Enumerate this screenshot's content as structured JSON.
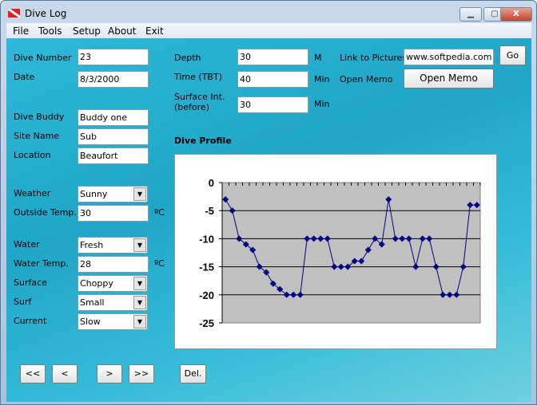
{
  "window": {
    "title": "Dive Log",
    "minimize": "▁",
    "maximize": "▢",
    "close": "X"
  },
  "menu": [
    "File",
    "Tools",
    "Setup",
    "About",
    "Exit"
  ],
  "fields": {
    "dive_number": {
      "label": "Dive Number",
      "value": "23"
    },
    "date": {
      "label": "Date",
      "value": "8/3/2000"
    },
    "dive_buddy": {
      "label": "Dive Buddy",
      "value": "Buddy one"
    },
    "site_name": {
      "label": "Site Name",
      "value": "Sub"
    },
    "location": {
      "label": "Location",
      "value": "Beaufort"
    },
    "weather": {
      "label": "Weather",
      "value": "Sunny"
    },
    "outside_temp": {
      "label": "Outside Temp.",
      "value": "30",
      "unit": "ºC"
    },
    "water": {
      "label": "Water",
      "value": "Fresh"
    },
    "water_temp": {
      "label": "Water Temp.",
      "value": "28",
      "unit": "ºC"
    },
    "surface": {
      "label": "Surface",
      "value": "Choppy"
    },
    "surf": {
      "label": "Surf",
      "value": "Small"
    },
    "current": {
      "label": "Current",
      "value": "Slow"
    },
    "depth": {
      "label": "Depth",
      "value": "30",
      "unit": "M"
    },
    "time": {
      "label": "Time (TBT)",
      "value": "40",
      "unit": "Min"
    },
    "surface_int": {
      "label": "Surface Int. (before)",
      "value": "30",
      "unit": "Min"
    },
    "link": {
      "label": "Link to Pictures",
      "value": "www.softpedia.com",
      "go": "Go"
    },
    "memo": {
      "label": "Open Memo",
      "button": "Open Memo"
    }
  },
  "nav": {
    "first": "<<",
    "prev": "<",
    "next": ">",
    "last": ">>",
    "delete": "Del."
  },
  "chart_data": {
    "type": "line",
    "title": "Dive Profile",
    "ylim": [
      -25,
      0
    ],
    "yticks": [
      "0",
      "-5",
      "-10",
      "-15",
      "-20",
      "-25"
    ],
    "values": [
      -3,
      -5,
      -10,
      -11,
      -12,
      -15,
      -16,
      -18,
      -19,
      -20,
      -20,
      -20,
      -10,
      -10,
      -10,
      -10,
      -15,
      -15,
      -15,
      -14,
      -14,
      -12,
      -10,
      -11,
      -3,
      -10,
      -10,
      -10,
      -15,
      -10,
      -10,
      -15,
      -20,
      -20,
      -20,
      -15,
      -4,
      -4
    ],
    "series_color": "#000080",
    "plot_bg": "#c0c0c0"
  }
}
